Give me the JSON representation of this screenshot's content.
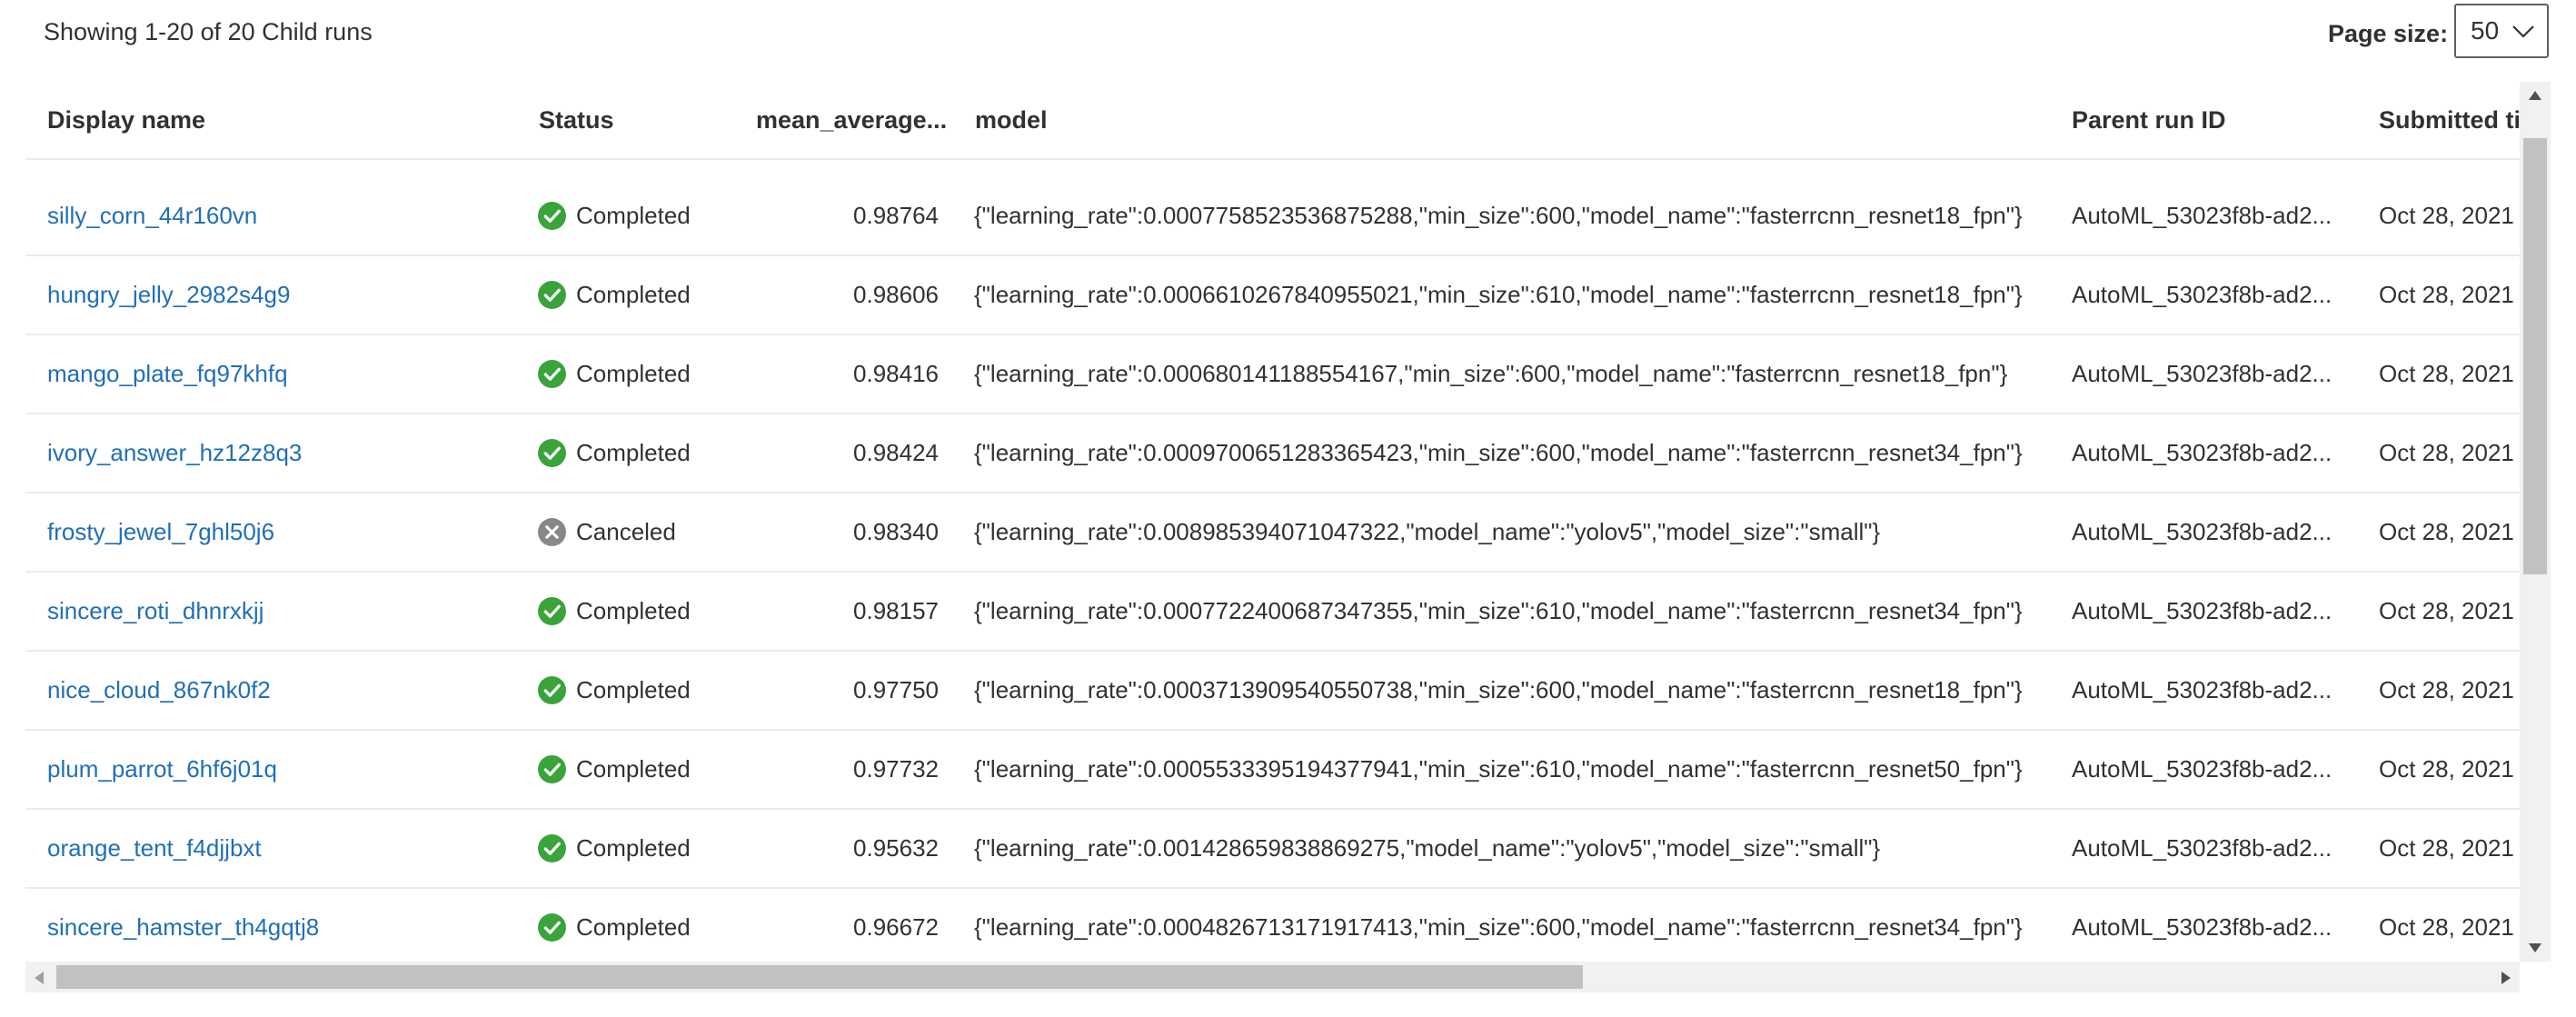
{
  "summary": "Showing 1-20 of 20 Child runs",
  "page_size": {
    "label": "Page size:",
    "value": "50"
  },
  "columns": {
    "display_name": "Display name",
    "status": "Status",
    "mean_average": "mean_average...",
    "model": "model",
    "parent_run_id": "Parent run ID",
    "submitted": "Submitted ti"
  },
  "colors": {
    "success": "#3aa43a",
    "canceled": "#8a8886",
    "link": "#1f6fb8"
  },
  "rows": [
    {
      "name": "silly_corn_44r160vn",
      "status": "Completed",
      "status_icon": "success-check-icon",
      "mean": "0.98764",
      "model": "{\"learning_rate\":0.0007758523536875288,\"min_size\":600,\"model_name\":\"fasterrcnn_resnet18_fpn\"}",
      "parent": "AutoML_53023f8b-ad2...",
      "submitted": "Oct 28, 2021"
    },
    {
      "name": "hungry_jelly_2982s4g9",
      "status": "Completed",
      "status_icon": "success-check-icon",
      "mean": "0.98606",
      "model": "{\"learning_rate\":0.0006610267840955021,\"min_size\":610,\"model_name\":\"fasterrcnn_resnet18_fpn\"}",
      "parent": "AutoML_53023f8b-ad2...",
      "submitted": "Oct 28, 2021"
    },
    {
      "name": "mango_plate_fq97khfq",
      "status": "Completed",
      "status_icon": "success-check-icon",
      "mean": "0.98416",
      "model": "{\"learning_rate\":0.000680141188554167,\"min_size\":600,\"model_name\":\"fasterrcnn_resnet18_fpn\"}",
      "parent": "AutoML_53023f8b-ad2...",
      "submitted": "Oct 28, 2021"
    },
    {
      "name": "ivory_answer_hz12z8q3",
      "status": "Completed",
      "status_icon": "success-check-icon",
      "mean": "0.98424",
      "model": "{\"learning_rate\":0.0009700651283365423,\"min_size\":600,\"model_name\":\"fasterrcnn_resnet34_fpn\"}",
      "parent": "AutoML_53023f8b-ad2...",
      "submitted": "Oct 28, 2021"
    },
    {
      "name": "frosty_jewel_7ghl50j6",
      "status": "Canceled",
      "status_icon": "canceled-x-icon",
      "mean": "0.98340",
      "model": "{\"learning_rate\":0.008985394071047322,\"model_name\":\"yolov5\",\"model_size\":\"small\"}",
      "parent": "AutoML_53023f8b-ad2...",
      "submitted": "Oct 28, 2021"
    },
    {
      "name": "sincere_roti_dhnrxkjj",
      "status": "Completed",
      "status_icon": "success-check-icon",
      "mean": "0.98157",
      "model": "{\"learning_rate\":0.0007722400687347355,\"min_size\":610,\"model_name\":\"fasterrcnn_resnet34_fpn\"}",
      "parent": "AutoML_53023f8b-ad2...",
      "submitted": "Oct 28, 2021"
    },
    {
      "name": "nice_cloud_867nk0f2",
      "status": "Completed",
      "status_icon": "success-check-icon",
      "mean": "0.97750",
      "model": "{\"learning_rate\":0.0003713909540550738,\"min_size\":600,\"model_name\":\"fasterrcnn_resnet18_fpn\"}",
      "parent": "AutoML_53023f8b-ad2...",
      "submitted": "Oct 28, 2021"
    },
    {
      "name": "plum_parrot_6hf6j01q",
      "status": "Completed",
      "status_icon": "success-check-icon",
      "mean": "0.97732",
      "model": "{\"learning_rate\":0.0005533395194377941,\"min_size\":610,\"model_name\":\"fasterrcnn_resnet50_fpn\"}",
      "parent": "AutoML_53023f8b-ad2...",
      "submitted": "Oct 28, 2021"
    },
    {
      "name": "orange_tent_f4djjbxt",
      "status": "Completed",
      "status_icon": "success-check-icon",
      "mean": "0.95632",
      "model": "{\"learning_rate\":0.001428659838869275,\"model_name\":\"yolov5\",\"model_size\":\"small\"}",
      "parent": "AutoML_53023f8b-ad2...",
      "submitted": "Oct 28, 2021"
    },
    {
      "name": "sincere_hamster_th4gqtj8",
      "status": "Completed",
      "status_icon": "success-check-icon",
      "mean": "0.96672",
      "model": "{\"learning_rate\":0.0004826713171917413,\"min_size\":600,\"model_name\":\"fasterrcnn_resnet34_fpn\"}",
      "parent": "AutoML_53023f8b-ad2...",
      "submitted": "Oct 28, 2021"
    }
  ]
}
